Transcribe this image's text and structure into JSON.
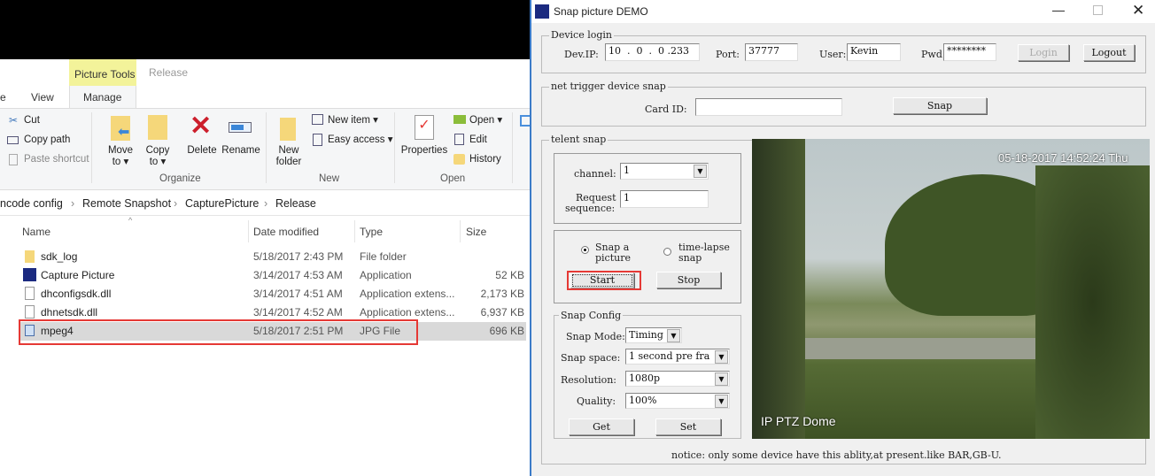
{
  "explorer": {
    "tabs": {
      "picture_tools": "Picture Tools",
      "release": "Release",
      "home_partial": "e",
      "view": "View",
      "manage": "Manage"
    },
    "ribbon": {
      "cut": "Cut",
      "copy_path": "Copy path",
      "paste_shortcut": "Paste shortcut",
      "move_to": "Move to ▾",
      "copy_to": "Copy to ▾",
      "delete": "Delete",
      "rename": "Rename",
      "new_folder": "New folder",
      "new_item": "New item ▾",
      "easy_access": "Easy access ▾",
      "properties": "Properties",
      "open": "Open ▾",
      "edit": "Edit",
      "history": "History",
      "organize": "Organize",
      "new": "New",
      "open_group": "Open"
    },
    "breadcrumb": [
      "ncode config",
      "Remote Snapshot",
      "CapturePicture",
      "Release"
    ],
    "columns": {
      "name": "Name",
      "date": "Date modified",
      "type": "Type",
      "size": "Size"
    },
    "files": [
      {
        "name": "sdk_log",
        "date": "5/18/2017 2:43 PM",
        "type": "File folder",
        "size": "",
        "icon": "folder-icon"
      },
      {
        "name": "Capture Picture",
        "date": "3/14/2017 4:53 AM",
        "type": "Application",
        "size": "52 KB",
        "icon": "app-icon"
      },
      {
        "name": "dhconfigsdk.dll",
        "date": "3/14/2017 4:51 AM",
        "type": "Application extens...",
        "size": "2,173 KB",
        "icon": "dll-icon"
      },
      {
        "name": "dhnetsdk.dll",
        "date": "3/14/2017 4:52 AM",
        "type": "Application extens...",
        "size": "6,937 KB",
        "icon": "dll-icon"
      },
      {
        "name": "mpeg4",
        "date": "5/18/2017 2:51 PM",
        "type": "JPG File",
        "size": "696 KB",
        "icon": "image-icon",
        "selected": true
      }
    ]
  },
  "snap": {
    "title": "Snap picture DEMO",
    "device_login": {
      "legend": "Device login",
      "ip_label": "Dev.IP:",
      "ip": [
        "10",
        ".",
        "0",
        ".",
        "0",
        ".233"
      ],
      "port_label": "Port:",
      "port": "37777",
      "user_label": "User:",
      "user": "Kevin",
      "pwd_label": "Pwd:",
      "pwd": "********",
      "login": "Login",
      "logout": "Logout"
    },
    "net_trigger": {
      "legend": "net trigger device snap",
      "card_label": "Card ID:",
      "card": "",
      "snap": "Snap"
    },
    "telent": {
      "legend": "telent snap",
      "channel_label": "channel:",
      "channel": "1",
      "req_label1": "Request",
      "req_label2": "sequence:",
      "req": "1",
      "radio1": "Snap a",
      "radio1b": "picture",
      "radio2": "time-lapse",
      "radio2b": "snap",
      "start": "Start",
      "stop": "Stop"
    },
    "config": {
      "legend": "Snap Config",
      "mode_label": "Snap Mode:",
      "mode": "Timing",
      "space_label": "Snap space:",
      "space": "1 second pre fra",
      "res_label": "Resolution:",
      "res": "1080p",
      "quality_label": "Quality:",
      "quality": "100%",
      "get": "Get",
      "set": "Set"
    },
    "camera": {
      "timestamp": "05-18-2017 14:52:24 Thu",
      "label": "IP PTZ Dome"
    },
    "notice": "notice: only some device have this ablity,at present.like BAR,GB-U."
  },
  "colors": {
    "highlight": "#e53935",
    "picture_tools": "#f3f39a",
    "selected_row": "#d9d9d9"
  }
}
